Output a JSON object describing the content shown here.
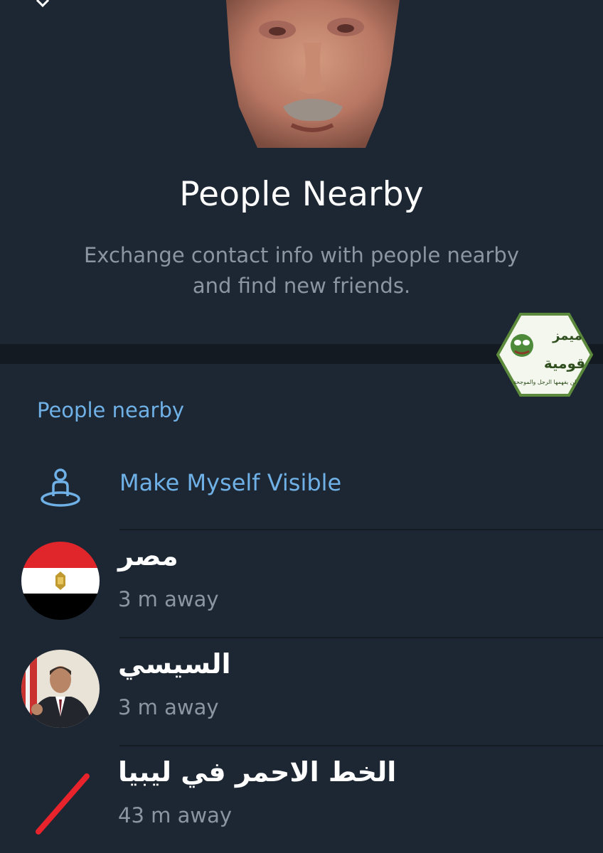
{
  "header": {
    "title": "People Nearby",
    "subtitle": "Exchange contact info with people nearby and find new friends."
  },
  "badge": {
    "line1": "ميمز",
    "line2": "قومية",
    "tagline": "لن يفهمها الرجل والموجحة"
  },
  "section": {
    "label": "People nearby"
  },
  "make_visible": {
    "label": "Make Myself Visible",
    "icon": "person-pin-icon"
  },
  "people": [
    {
      "name": "مصر",
      "distance": "3 m away",
      "avatar": "egypt-flag"
    },
    {
      "name": "السيسي",
      "distance": "3 m away",
      "avatar": "portrait-photo"
    },
    {
      "name": "الخط الاحمر في ليبيا",
      "distance": "43 m away",
      "avatar": "red-line"
    }
  ],
  "colors": {
    "background": "#1d2733",
    "accent": "#6fb1e6",
    "secondary_text": "#8b96a3",
    "red_line": "#e8232b"
  }
}
